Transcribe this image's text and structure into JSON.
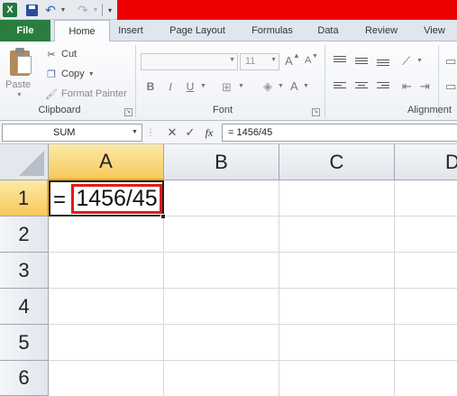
{
  "window": {
    "title_bar_color": "#ee0000"
  },
  "app_icon": "excel-logo",
  "app_icon_letter": "X",
  "qat": {
    "save_icon": "save-icon",
    "undo_icon": "undo-icon",
    "redo_icon": "redo-icon",
    "customize_icon": "customize-qat-icon"
  },
  "tabs": [
    {
      "label": "File"
    },
    {
      "label": "Home"
    },
    {
      "label": "Insert"
    },
    {
      "label": "Page Layout"
    },
    {
      "label": "Formulas"
    },
    {
      "label": "Data"
    },
    {
      "label": "Review"
    },
    {
      "label": "View"
    }
  ],
  "ribbon": {
    "clipboard": {
      "paste_label": "Paste",
      "cut_label": "Cut",
      "copy_label": "Copy",
      "format_painter_label": "Format Painter",
      "group_label": "Clipboard"
    },
    "font": {
      "font_name_value": "",
      "font_size_value": "11",
      "bold": "B",
      "italic": "I",
      "underline": "U",
      "grow_font": "A",
      "shrink_font": "A",
      "font_color": "A",
      "group_label": "Font"
    },
    "alignment": {
      "group_label": "Alignment"
    }
  },
  "formula_bar": {
    "name_box_value": "SUM",
    "cancel_glyph": "✕",
    "enter_glyph": "✓",
    "function_glyph": "fx",
    "formula_value": "= 1456/45"
  },
  "sheet": {
    "columns": [
      "A",
      "B",
      "C",
      "D"
    ],
    "rows": [
      "1",
      "2",
      "3",
      "4",
      "5",
      "6"
    ],
    "active_cell": "A1",
    "active_cell_prefix": "=",
    "active_cell_content": "1456/45",
    "highlight_color": "#e31b1b"
  }
}
